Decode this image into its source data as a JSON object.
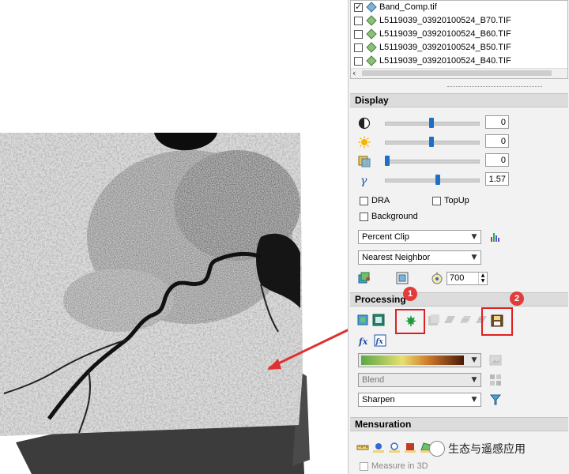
{
  "layers": [
    {
      "name": "Band_Comp.tif",
      "checked": true
    },
    {
      "name": "L5119039_03920100524_B70.TIF",
      "checked": false
    },
    {
      "name": "L5119039_03920100524_B60.TIF",
      "checked": false
    },
    {
      "name": "L5119039_03920100524_B50.TIF",
      "checked": false
    },
    {
      "name": "L5119039_03920100524_B40.TIF",
      "checked": false
    }
  ],
  "display": {
    "header": "Display",
    "sliders": [
      {
        "name": "contrast",
        "icon": "contrast-icon",
        "value": "0",
        "level": 0.5
      },
      {
        "name": "brightness",
        "icon": "brightness-icon",
        "value": "0",
        "level": 0.5
      },
      {
        "name": "transparency",
        "icon": "transparency-icon",
        "value": "0",
        "level": 0.0
      },
      {
        "name": "gamma",
        "icon": "gamma-icon",
        "value": "1.57",
        "level": 0.57
      }
    ],
    "dra_label": "DRA",
    "topup_label": "TopUp",
    "background_label": "Background",
    "stretch_value": "Percent Clip",
    "resampling_value": "Nearest Neighbor",
    "resolution_value": "700"
  },
  "processing": {
    "header": "Processing",
    "colormap_value": "",
    "blend_value": "Blend",
    "sharpen_value": "Sharpen",
    "badge_1": "1",
    "badge_2": "2",
    "highlight_color": "#e02020"
  },
  "mensuration": {
    "header": "Mensuration",
    "measure_3d_label": "Measure in 3D"
  },
  "watermark": {
    "text": "生态与遥感应用"
  }
}
